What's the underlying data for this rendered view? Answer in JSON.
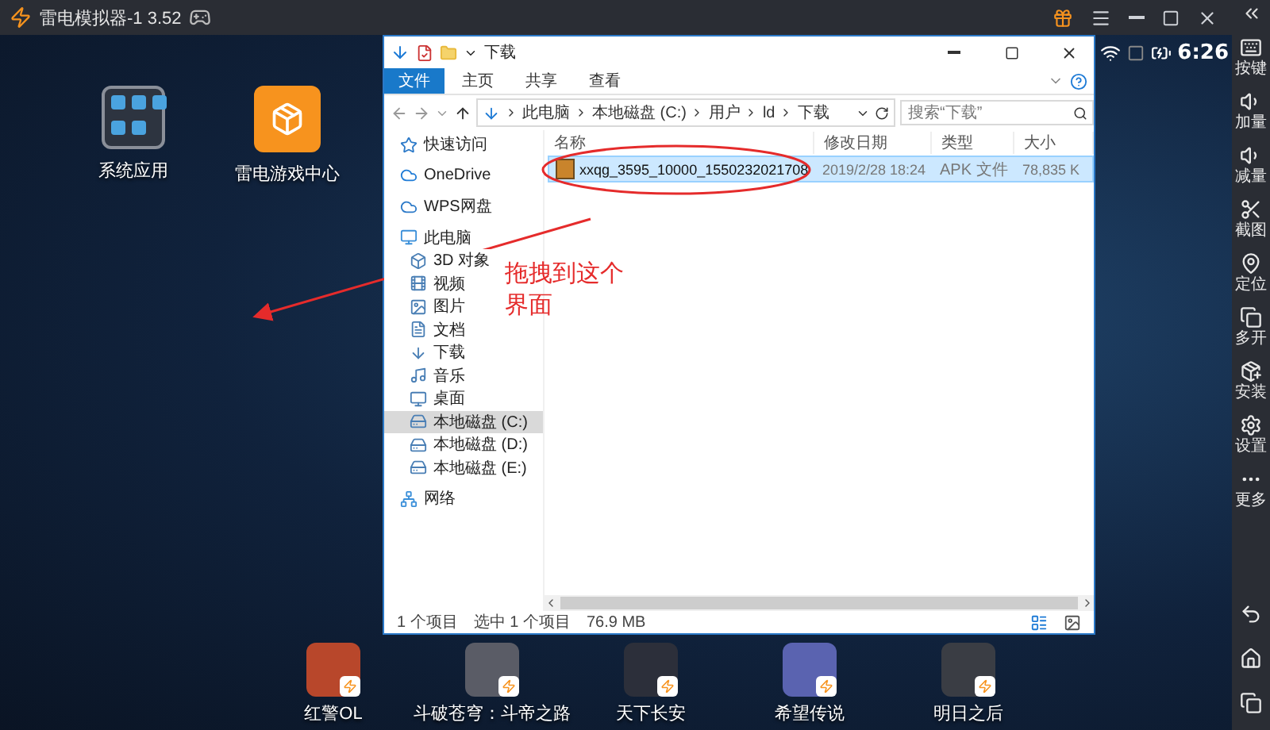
{
  "emulator": {
    "title": "雷电模拟器-1 3.52"
  },
  "status": {
    "time": "6:26"
  },
  "sidebar": {
    "items": [
      {
        "label": "按键"
      },
      {
        "label": "加量"
      },
      {
        "label": "减量"
      },
      {
        "label": "截图"
      },
      {
        "label": "定位"
      },
      {
        "label": "多开"
      },
      {
        "label": "安装"
      },
      {
        "label": "设置"
      },
      {
        "label": "更多"
      }
    ]
  },
  "desktop_apps": [
    {
      "label": "系统应用"
    },
    {
      "label": "雷电游戏中心"
    }
  ],
  "dock_apps": [
    {
      "label": "红警OL"
    },
    {
      "label": "斗破苍穹：斗帝之路"
    },
    {
      "label": "天下长安"
    },
    {
      "label": "希望传说"
    },
    {
      "label": "明日之后"
    }
  ],
  "explorer": {
    "title": "下载",
    "tabs": [
      {
        "label": "文件",
        "selected": true
      },
      {
        "label": "主页",
        "selected": false
      },
      {
        "label": "共享",
        "selected": false
      },
      {
        "label": "查看",
        "selected": false
      }
    ],
    "address": [
      "此电脑",
      "本地磁盘 (C:)",
      "用户",
      "ld",
      "下载"
    ],
    "search": {
      "placeholder": "搜索“下载”"
    },
    "nav": [
      {
        "label": "快速访问",
        "selected": false
      },
      {
        "label": "OneDrive",
        "selected": false
      },
      {
        "label": "WPS网盘",
        "selected": false
      },
      {
        "label": "此电脑",
        "selected": false,
        "children": [
          {
            "label": "3D 对象",
            "selected": false
          },
          {
            "label": "视频",
            "selected": false
          },
          {
            "label": "图片",
            "selected": false
          },
          {
            "label": "文档",
            "selected": false
          },
          {
            "label": "下载",
            "selected": false
          },
          {
            "label": "音乐",
            "selected": false
          },
          {
            "label": "桌面",
            "selected": false
          },
          {
            "label": "本地磁盘 (C:)",
            "selected": true
          },
          {
            "label": "本地磁盘 (D:)",
            "selected": false
          },
          {
            "label": "本地磁盘 (E:)",
            "selected": false
          }
        ]
      },
      {
        "label": "网络",
        "selected": false
      }
    ],
    "columns": [
      "名称",
      "修改日期",
      "类型",
      "大小"
    ],
    "files": [
      {
        "name": "xxqg_3595_10000_1550232021708",
        "modified": "2019/2/28 18:24",
        "type": "APK 文件",
        "size": "78,835 K",
        "selected": true
      }
    ],
    "status": {
      "count": "1 个项目",
      "selection": "选中 1 个项目",
      "size": "76.9 MB"
    }
  },
  "annotation": {
    "lines": [
      "拖拽到这个",
      "界面"
    ]
  }
}
